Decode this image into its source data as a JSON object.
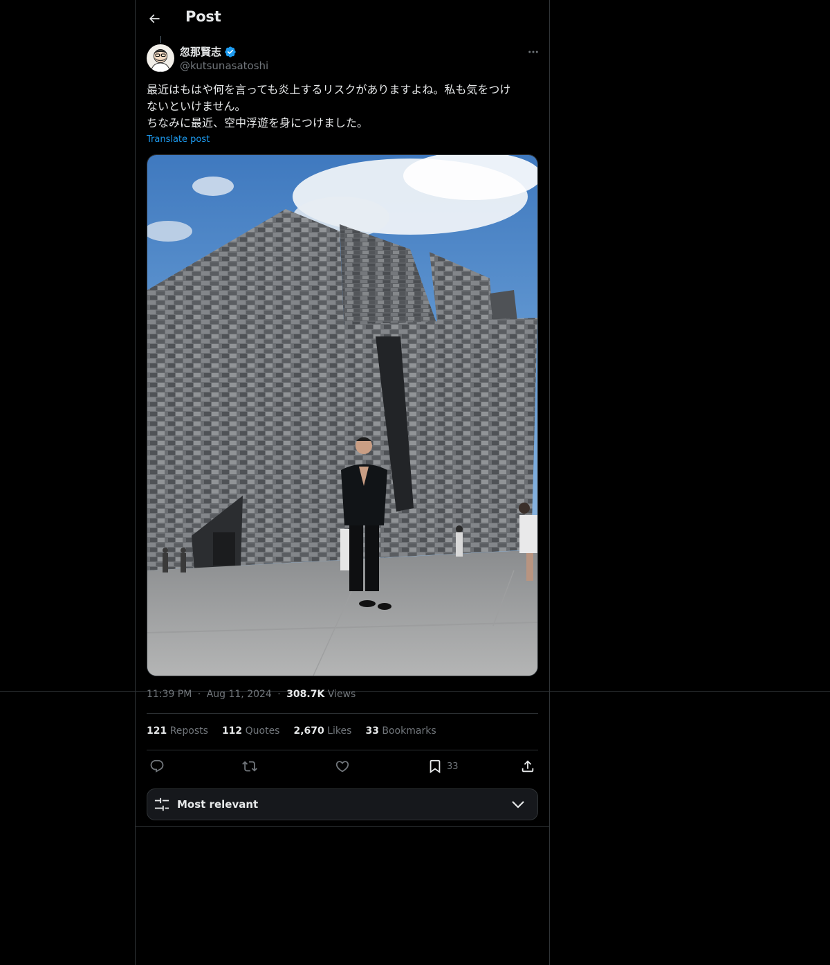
{
  "header": {
    "title": "Post"
  },
  "author": {
    "display_name": "忽那賢志",
    "handle": "@kutsunasatoshi",
    "verified": true
  },
  "post": {
    "text_lines": [
      "最近はもはや何を言っても炎上するリスクがありますよね。私も気をつけ",
      "ないといけません。",
      "ちなみに最近、空中浮遊を身につけました。"
    ],
    "translate_label": "Translate post",
    "time": "11:39 PM",
    "date": "Aug 11, 2024",
    "views_count": "308.7K",
    "views_label": "Views",
    "dot": "·"
  },
  "stats": {
    "reposts": {
      "count": "121",
      "label": "Reposts"
    },
    "quotes": {
      "count": "112",
      "label": "Quotes"
    },
    "likes": {
      "count": "2,670",
      "label": "Likes"
    },
    "bookmarks": {
      "count": "33",
      "label": "Bookmarks"
    }
  },
  "actions": {
    "bookmark_count": "33"
  },
  "sort": {
    "label": "Most relevant"
  },
  "colors": {
    "background": "#000000",
    "border": "#2f3336",
    "text_primary": "#e7e9ea",
    "text_secondary": "#71767b",
    "accent": "#1d9bf0",
    "sort_bar_bg": "#16181c"
  },
  "icons": {
    "back": "arrow-left-icon",
    "verified": "verified-badge-icon",
    "more": "more-horizontal-icon",
    "reply": "reply-icon",
    "repost": "repost-icon",
    "like": "heart-icon",
    "bookmark": "bookmark-icon",
    "share": "share-icon",
    "sort": "sliders-icon",
    "dropdown": "chevron-down-icon"
  }
}
